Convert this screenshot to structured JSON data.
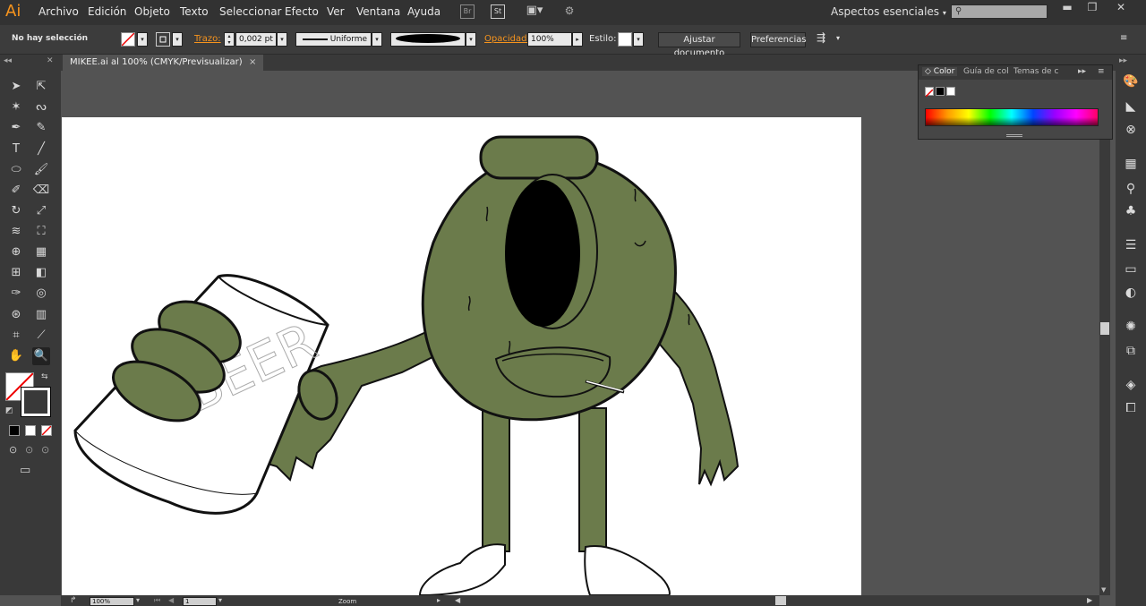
{
  "app": {
    "logo": "Ai"
  },
  "menu": [
    "Archivo",
    "Edición",
    "Objeto",
    "Texto",
    "Seleccionar",
    "Efecto",
    "Ver",
    "Ventana",
    "Ayuda"
  ],
  "menubar_icons": {
    "bridge": "Br",
    "stock": "St"
  },
  "workspace": {
    "label": "Aspectos esenciales"
  },
  "search": {
    "placeholder": ""
  },
  "control": {
    "selection_status": "No hay selección",
    "stroke_label": "Trazo:",
    "stroke_weight": "0,002 pt",
    "stroke_profile": "Uniforme",
    "opacity_label": "Opacidad:",
    "opacity_value": "100%",
    "style_label": "Estilo:",
    "fit_document": "Ajustar documento",
    "preferences": "Preferencias"
  },
  "document_tab": {
    "title": "MIKEE.ai al 100% (CMYK/Previsualizar)",
    "close": "×"
  },
  "color_panel": {
    "tabs": [
      "Color",
      "Guía de col",
      "Temas de c"
    ]
  },
  "status_bar": {
    "zoom": "100%",
    "page": "1",
    "tool_label": "Zoom"
  },
  "colors": {
    "monster_green": "#6b7b4b",
    "accent": "#f7941d"
  },
  "artboard_text": "BEER"
}
